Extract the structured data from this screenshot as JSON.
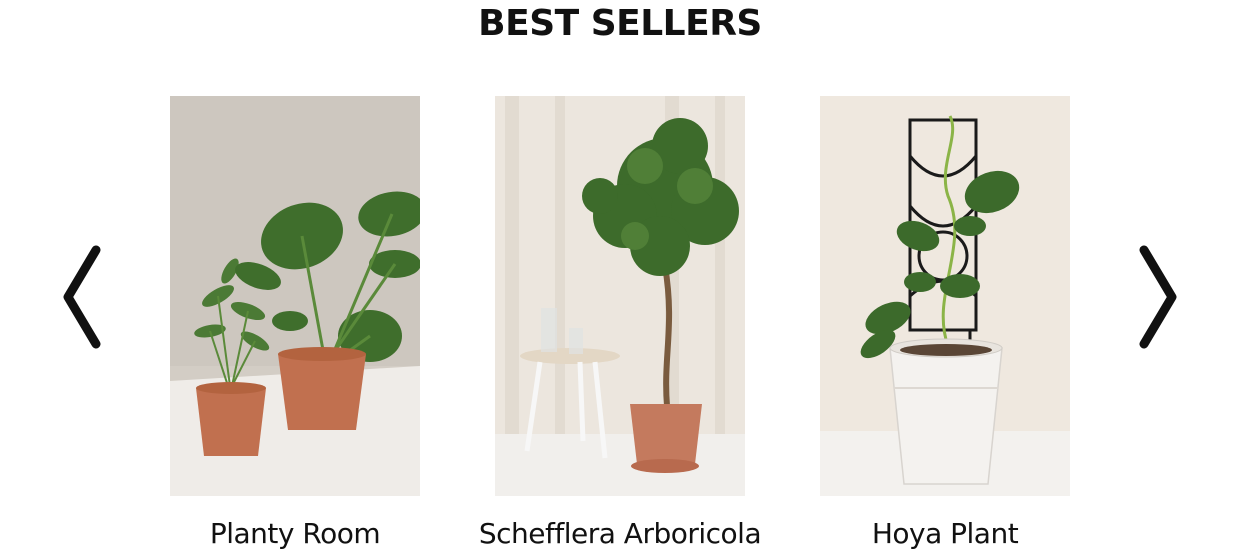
{
  "section": {
    "title": "BEST SELLERS"
  },
  "carousel": {
    "prev_icon": "chevron-left-icon",
    "next_icon": "chevron-right-icon",
    "products": [
      {
        "name": "Planty Room"
      },
      {
        "name": "Schefflera Arboricola"
      },
      {
        "name": "Hoya Plant"
      }
    ]
  },
  "colors": {
    "text": "#111111",
    "pot_terracotta": "#c1704f",
    "leaf_green": "#3f6e2c"
  }
}
